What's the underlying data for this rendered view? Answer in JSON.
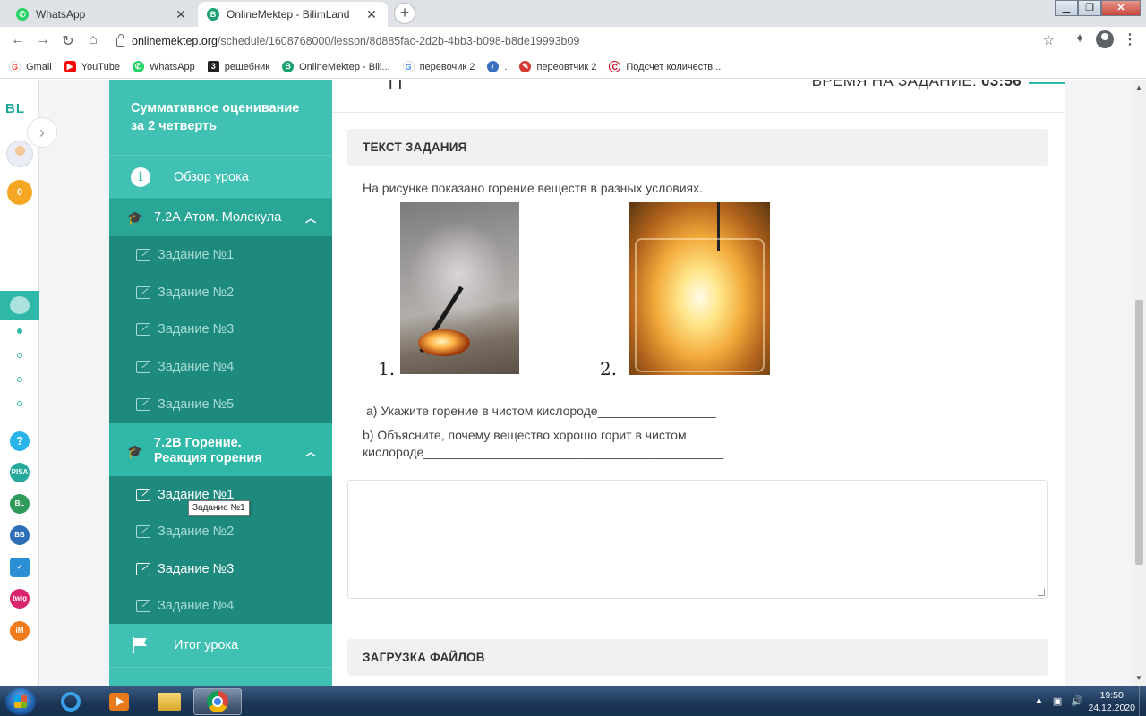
{
  "browser": {
    "tabs": [
      {
        "title": "WhatsApp",
        "active": false
      },
      {
        "title": "OnlineMektep - BilimLand",
        "active": true
      }
    ],
    "url_host": "onlinemektep.org",
    "url_path": "/schedule/1608768000/lesson/8d885fac-2d2b-4bb3-b098-b8de19993b09",
    "bookmarks": [
      {
        "label": "Gmail",
        "icon": "google-icon"
      },
      {
        "label": "YouTube",
        "icon": "youtube-icon"
      },
      {
        "label": "WhatsApp",
        "icon": "whatsapp-icon"
      },
      {
        "label": "решебник",
        "icon": "reshebnik-icon"
      },
      {
        "label": "OnlineMektep - Bili...",
        "icon": "onlinemektep-icon"
      },
      {
        "label": "перевочик 2",
        "icon": "google-icon"
      },
      {
        "label": ".",
        "icon": "globe-icon"
      },
      {
        "label": "переовтчик 2",
        "icon": "translator-icon"
      },
      {
        "label": "Подсчет количеств...",
        "icon": "copyright-icon"
      }
    ]
  },
  "rail": {
    "logo": "BL",
    "coins": "0"
  },
  "sidebar": {
    "title": "Суммативное оценивание за 2 четверть",
    "overview": "Обзор урока",
    "groups": [
      {
        "label": "7.2А Атом. Молекула",
        "items": [
          "Задание №1",
          "Задание №2",
          "Задание №3",
          "Задание №4",
          "Задание №5"
        ]
      },
      {
        "label": "7.2В Горение. Реакция горения",
        "items": [
          "Задание №1",
          "Задание №2",
          "Задание №3",
          "Задание №4"
        ]
      }
    ],
    "final": "Итог урока",
    "tooltip": "Задание №1"
  },
  "main": {
    "timer_label": "ВРЕМЯ НА ЗАДАНИЕ:",
    "timer_value": "03:56",
    "task_header": "ТЕКСТ ЗАДАНИЯ",
    "intro": "На рисунке показано горение веществ в разных условиях.",
    "fig1_label": "1.",
    "fig2_label": "2.",
    "question_a": "a) Укажите горение в чистом кислороде_________________",
    "question_b": "b) Объясните, почему вещество хорошо горит в чистом кислороде___________________________________________",
    "upload_header": "ЗАГРУЗКА ФАЙЛОВ"
  },
  "taskbar": {
    "time": "19:50",
    "date": "24.12.2020"
  }
}
